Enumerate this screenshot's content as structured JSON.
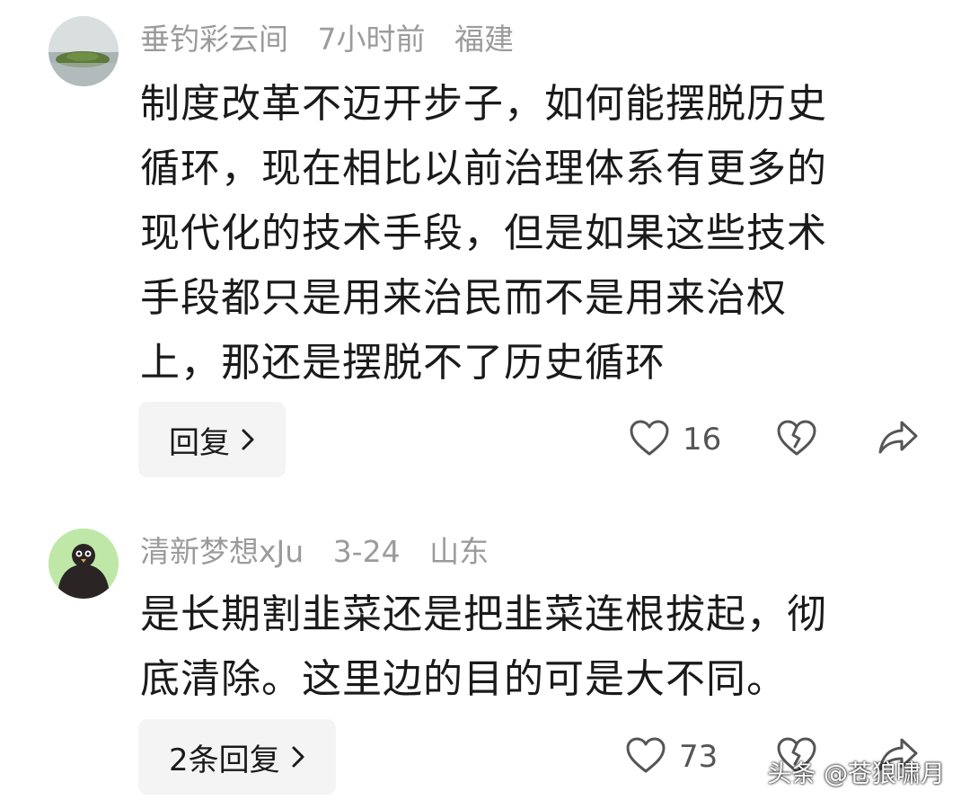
{
  "comments": [
    {
      "username": "垂钓彩云间",
      "time": "7小时前",
      "location": "福建",
      "avatar_icon": "landscape-avatar",
      "text_lines": [
        "制度改革不迈开步子，如何能摆脱历史",
        "循环，现在相比以前治理体系有更多的",
        "现代化的技术手段，但是如果这些技术",
        "手段都只是用来治民而不是用来治权",
        "上，那还是摆脱不了历史循环"
      ],
      "reply_label": "回复",
      "like_count": "16"
    },
    {
      "username": "清新梦想xJu",
      "time": "3-24",
      "location": "山东",
      "avatar_icon": "penguin-avatar",
      "text_lines": [
        "是长期割韭菜还是把韭菜连根拔起，彻",
        "底清除。这里边的目的可是大不同。"
      ],
      "reply_label": "2条回复",
      "like_count": "73"
    }
  ],
  "watermark": "头条 @苍狼啸月",
  "colors": {
    "meta_text": "#9b9b9b",
    "body_text": "#1a1a1a",
    "reply_bg": "#f4f4f4",
    "avatar2_bg": "#bfe8a8"
  }
}
